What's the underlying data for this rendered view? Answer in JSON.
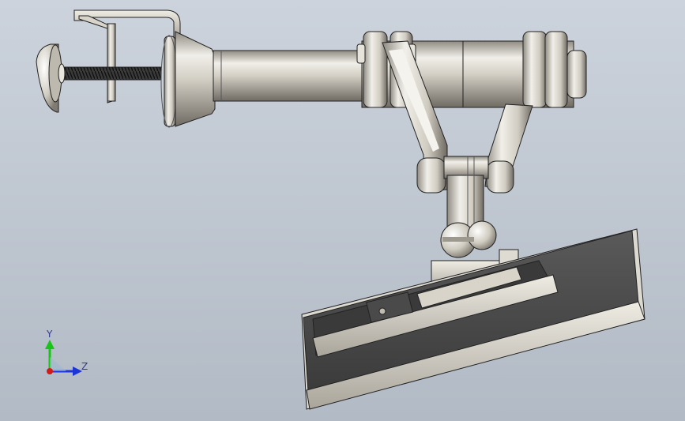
{
  "triad": {
    "y_label": "Y",
    "z_label": "Z",
    "colors": {
      "y": "#19c419",
      "z": "#1c34d8",
      "origin": "#d21a1a",
      "label": "#2d3b8f"
    }
  },
  "colors": {
    "metal_light": "#f2f0ea",
    "metal_mid": "#cfcbc0",
    "metal_dark": "#8e8a80",
    "screen_dark": "#4a4a4a",
    "outline": "#222222"
  }
}
